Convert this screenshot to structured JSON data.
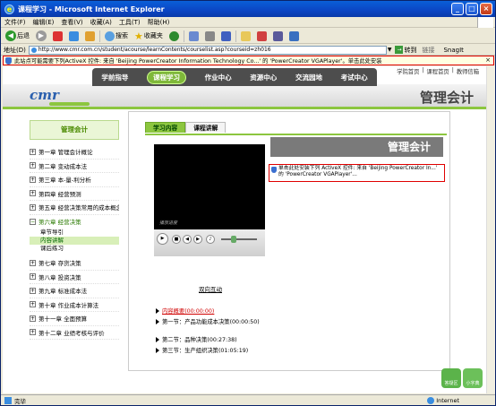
{
  "window": {
    "title": "课程学习 - Microsoft Internet Explorer"
  },
  "menu": [
    "文件(F)",
    "编辑(E)",
    "查看(V)",
    "收藏(A)",
    "工具(T)",
    "帮助(H)"
  ],
  "toolbar": {
    "back": "后退",
    "search": "搜索",
    "favorites": "收藏夹"
  },
  "address": {
    "label": "地址(D)",
    "url": "http://www.cmr.com.cn/student/acourse/learnContents/courselist.asp?courseid=zh016",
    "go": "转到",
    "links": "链接",
    "snagit": "SnagIt"
  },
  "infobar": {
    "text": "此站点可能需要下列ActiveX 控件: 来自 'Beijing PowerCreator Information Technology Co...' 的 'PowerCreator VGAPlayer'。单击此处安装"
  },
  "page": {
    "top_links": [
      "学院首页",
      "课程首页",
      "教师信箱"
    ],
    "nav": [
      "学前指导",
      "课程学习",
      "作业中心",
      "资源中心",
      "交流园地",
      "考试中心"
    ],
    "nav_active": "课程学习",
    "logo": "cmr",
    "title": "管理会计"
  },
  "sidebar": {
    "heading": "管理会计",
    "chapters": [
      "第一章 管理会计概论",
      "第二章 变动成本法",
      "第三章 本-量-利分析",
      "第四章 经营预测",
      "第五章 经营决策常用的成本概念"
    ],
    "open_chapter": "第六章 经营决策",
    "sub_items": [
      "章节导引",
      "内容讲解",
      "课后练习"
    ],
    "selected_sub": "内容讲解",
    "chapters_after": [
      "第七章 存货决策",
      "第八章 投资决策",
      "第九章 标准成本法",
      "第十章 作业成本计算法",
      "第十一章 全面预算",
      "第十二章 业绩考核与评价"
    ]
  },
  "tabs": [
    "学习内容",
    "课程讲解"
  ],
  "tab_active": "学习内容",
  "player": {
    "label": "播放进度",
    "interact": "双向互动"
  },
  "lessons": [
    {
      "text": "内容概要(00:00:00)",
      "highlight": true
    },
    {
      "text": "第一节：产品功能成本决策(00:00:50)",
      "highlight": false
    },
    {
      "text": "第二节：品种决策(00:27:38)",
      "highlight": false
    },
    {
      "text": "第三节：生产组织决策(01:05:19)",
      "highlight": false
    }
  ],
  "course_banner": "管理会计",
  "activex_notice": "单击此处安装下列 ActiveX 控件: 来自 'Beijing PowerCreator In...' 的 'PowerCreator VGAPlayer'...",
  "footer_buttons": [
    "答疑区",
    "小字典"
  ],
  "status": {
    "text": "完毕",
    "zone": "Internet"
  }
}
